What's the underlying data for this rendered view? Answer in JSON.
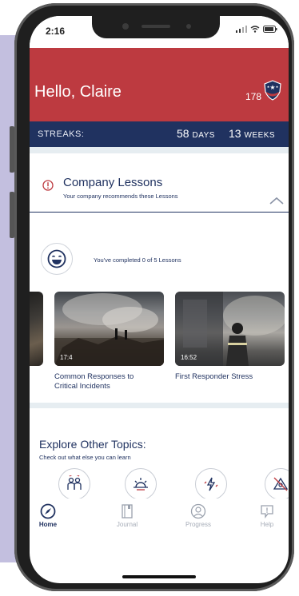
{
  "status": {
    "time": "2:16",
    "icons": "signal-icon wifi-icon battery-icon"
  },
  "header": {
    "greeting": "Hello, Claire",
    "points": "178"
  },
  "streaks": {
    "label": "STREAKS:",
    "days_value": "58",
    "days_unit": "DAYS",
    "weeks_value": "13",
    "weeks_unit": "WEEKS"
  },
  "lessons": {
    "title": "Company Lessons",
    "subtitle": "Your company recommends these Lessons",
    "completed": "You've completed 0 of 5 Lessons",
    "items": [
      {
        "title": "Common Responses to Critical Incidents",
        "duration": "17:4"
      },
      {
        "title": "First Responder Stress",
        "duration": "16:52"
      }
    ]
  },
  "topics": {
    "title": "Explore Other Topics:",
    "subtitle": "Check out what else you can learn",
    "icons": [
      "family-icon",
      "sunrise-icon",
      "lightning-icon",
      "alert-icon"
    ]
  },
  "tabs": [
    {
      "label": "Home",
      "icon": "compass-icon",
      "active": true
    },
    {
      "label": "Journal",
      "icon": "journal-icon",
      "active": false
    },
    {
      "label": "Progress",
      "icon": "progress-icon",
      "active": false
    },
    {
      "label": "Help",
      "icon": "help-icon",
      "active": false
    }
  ],
  "colors": {
    "header_red": "#bd3a40",
    "navy": "#203260",
    "band": "#e6edf1",
    "lavender": "#c3bfdf"
  }
}
